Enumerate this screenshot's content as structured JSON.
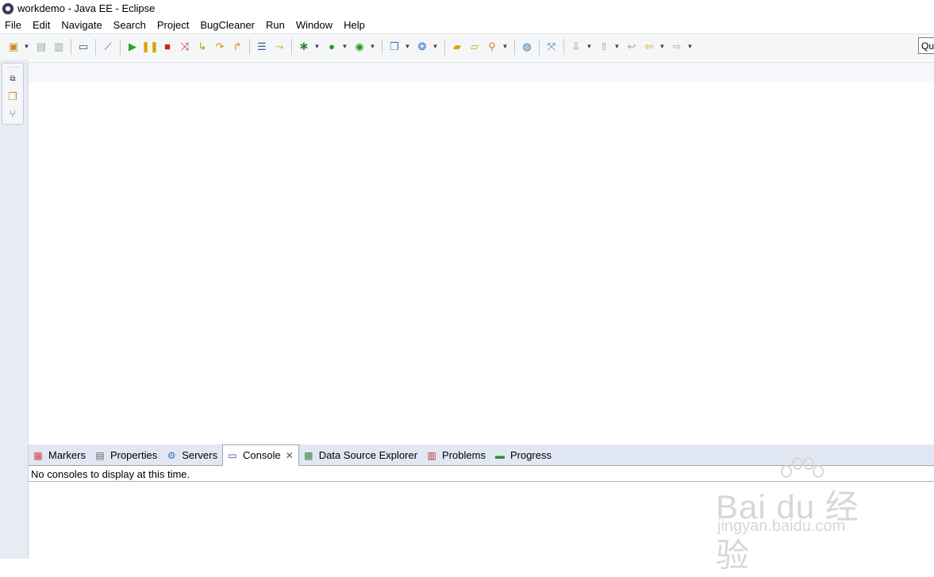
{
  "window": {
    "title": "workdemo - Java EE - Eclipse"
  },
  "menu": [
    "File",
    "Edit",
    "Navigate",
    "Search",
    "Project",
    "BugCleaner",
    "Run",
    "Window",
    "Help"
  ],
  "quick_access": {
    "placeholder": "Qu"
  },
  "toolbar_icons": [
    "new-wizard-icon",
    "save-icon",
    "save-all-icon",
    "open-console-icon",
    "skip-breakpoints-icon",
    "resume-icon",
    "suspend-icon",
    "terminate-icon",
    "disconnect-icon",
    "step-into-icon",
    "step-over-icon",
    "step-return-icon",
    "drop-to-frame-icon",
    "use-step-filters-icon",
    "debug-icon",
    "run-icon",
    "external-tools-icon",
    "new-server-icon",
    "new-web-service-icon",
    "open-type-icon",
    "open-task-icon",
    "search-icon",
    "browser-icon",
    "open-perspective-icon",
    "next-annotation-icon",
    "prev-annotation-icon",
    "last-edit-icon",
    "back-icon",
    "forward-icon"
  ],
  "bottom_panel": {
    "tabs": [
      {
        "label": "Markers",
        "icon": "markers-icon"
      },
      {
        "label": "Properties",
        "icon": "properties-icon"
      },
      {
        "label": "Servers",
        "icon": "servers-icon"
      },
      {
        "label": "Console",
        "icon": "console-icon",
        "active": true,
        "close": "✕"
      },
      {
        "label": "Data Source Explorer",
        "icon": "data-source-icon"
      },
      {
        "label": "Problems",
        "icon": "problems-icon"
      },
      {
        "label": "Progress",
        "icon": "progress-icon"
      }
    ],
    "console_message": "No consoles to display at this time."
  },
  "watermark": {
    "brand": "Bai du 经验",
    "url": "jingyan.baidu.com"
  }
}
